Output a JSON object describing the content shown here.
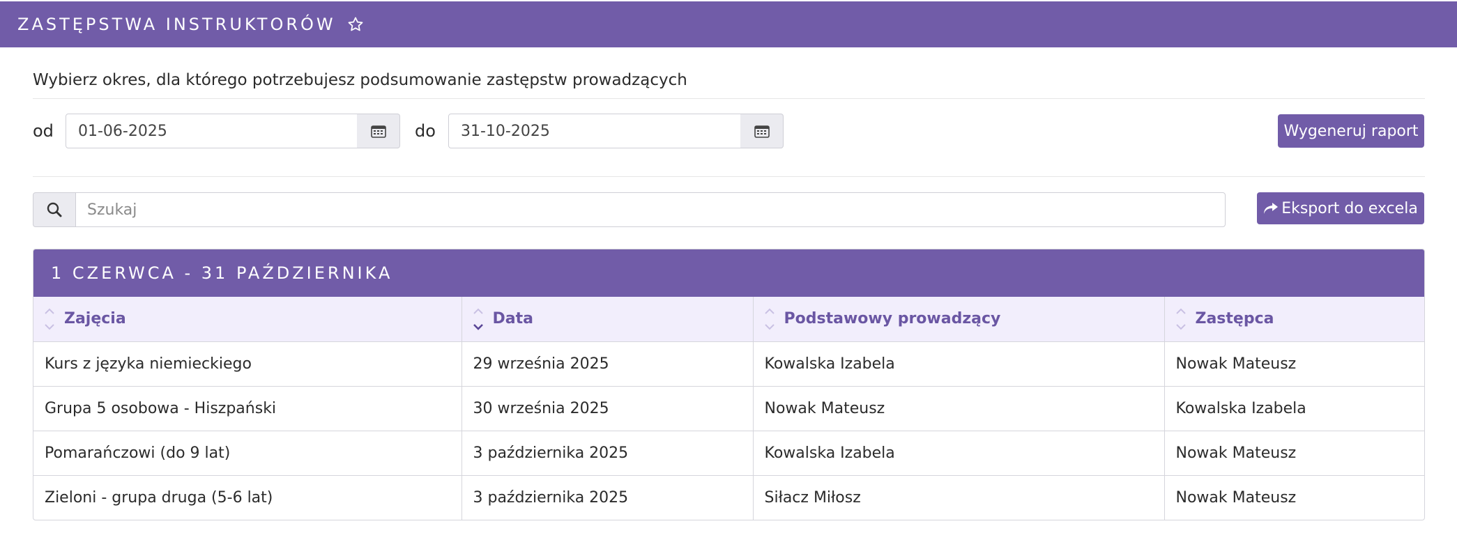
{
  "header": {
    "title": "ZASTĘPSTWA INSTRUKTORÓW",
    "star_icon": "star-outline-icon"
  },
  "intro": "Wybierz okres, dla którego potrzebujesz podsumowanie zastępstw prowadzących",
  "filters": {
    "from_label": "od",
    "from_value": "01-06-2025",
    "to_label": "do",
    "to_value": "31-10-2025",
    "generate_label": "Wygeneruj raport"
  },
  "search": {
    "placeholder": "Szukaj",
    "export_label": "Eksport do excela"
  },
  "report": {
    "title": "1 CZERWCA - 31 PAŹDZIERNIKA",
    "columns": [
      "Zajęcia",
      "Data",
      "Podstawowy prowadzący",
      "Zastępca"
    ],
    "sorted_column": "Data",
    "sort_direction": "desc",
    "rows": [
      [
        "Kurs z języka niemieckiego",
        "29 września 2025",
        "Kowalska Izabela",
        "Nowak Mateusz"
      ],
      [
        "Grupa 5 osobowa - Hiszpański",
        "30 września 2025",
        "Nowak Mateusz",
        "Kowalska Izabela"
      ],
      [
        "Pomarańczowi (do 9 lat)",
        "3 października 2025",
        "Kowalska Izabela",
        "Nowak Mateusz"
      ],
      [
        "Zieloni - grupa druga (5-6 lat)",
        "3 października 2025",
        "Siłacz Miłosz",
        "Nowak Mateusz"
      ]
    ]
  },
  "colors": {
    "accent": "#715ca8",
    "header_row_bg": "#f2eefc",
    "header_text": "#6a56a3"
  }
}
